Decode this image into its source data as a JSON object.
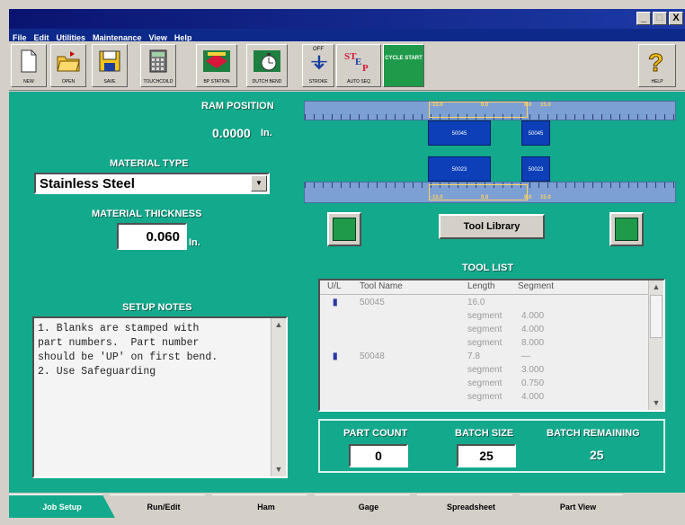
{
  "window": {
    "minimize": "_",
    "maximize": "□",
    "close": "X"
  },
  "menu": [
    "File",
    "Edit",
    "Utilities",
    "Maintenance",
    "View",
    "Help"
  ],
  "toolbar": [
    {
      "label": "NEW",
      "icon": "new-file-icon"
    },
    {
      "label": "OPEN",
      "icon": "folder-icon"
    },
    {
      "label": "SAVE",
      "icon": "floppy-disk-icon"
    },
    {
      "label": "TOUCHCOILD",
      "icon": "calculator-icon"
    },
    {
      "label": "BP STATION",
      "icon": "bp-station-icon"
    },
    {
      "label": "DUTCH BEND",
      "icon": "stopwatch-icon"
    },
    {
      "label": "STROKE",
      "icon": "stroke-arrows-icon",
      "top": "OFF"
    },
    {
      "label": "AUTO SEQ",
      "icon": "step-icon"
    },
    {
      "label": "CYCLE START",
      "icon": "cycle-start-icon"
    },
    {
      "label": "HELP",
      "icon": "question-mark-icon"
    }
  ],
  "ram_position": {
    "label": "RAM POSITION",
    "value": "0.0000",
    "unit": "In."
  },
  "material_type": {
    "label": "MATERIAL TYPE",
    "value": "Stainless Steel"
  },
  "material_thickness": {
    "label": "MATERIAL THICKNESS",
    "value": "0.060",
    "unit": "In."
  },
  "rulers": {
    "labels": [
      "-10.0",
      "0.0",
      "8.0",
      "15.0"
    ]
  },
  "tools": {
    "upper": [
      "50045",
      "50045"
    ],
    "lower": [
      "50023",
      "50023"
    ]
  },
  "tool_library_button": "Tool Library",
  "tool_list": {
    "title": "TOOL LIST",
    "headers": [
      "U/L",
      "Tool Name",
      "Length",
      "Segment"
    ],
    "rows": [
      {
        "name": "50045",
        "length": "16.0",
        "segment": ""
      },
      {
        "name": "",
        "length": "segment",
        "segment": "4.000"
      },
      {
        "name": "",
        "length": "segment",
        "segment": "4.000"
      },
      {
        "name": "",
        "length": "segment",
        "segment": "8.000"
      },
      {
        "name": "50048",
        "length": "7.8",
        "segment": "—"
      },
      {
        "name": "",
        "length": "segment",
        "segment": "3.000"
      },
      {
        "name": "",
        "length": "segment",
        "segment": "0.750"
      },
      {
        "name": "",
        "length": "segment",
        "segment": "4.000"
      }
    ]
  },
  "setup_notes": {
    "label": "SETUP NOTES",
    "lines": [
      "1. Blanks are stamped with",
      "part numbers.  Part number",
      "should be 'UP' on first bend.",
      "2. Use Safeguarding"
    ]
  },
  "counts": {
    "part_count_label": "PART COUNT",
    "part_count": "0",
    "batch_size_label": "BATCH SIZE",
    "batch_size": "25",
    "batch_remaining_label": "BATCH REMAINING",
    "batch_remaining": "25"
  },
  "tabs": [
    "Job Setup",
    "Run/Edit",
    "Ham",
    "Gage",
    "Spreadsheet",
    "Part View"
  ],
  "colors": {
    "background": "#13a98c",
    "tool_block": "#0c3fb8",
    "ruler": "#7c9fd4"
  }
}
